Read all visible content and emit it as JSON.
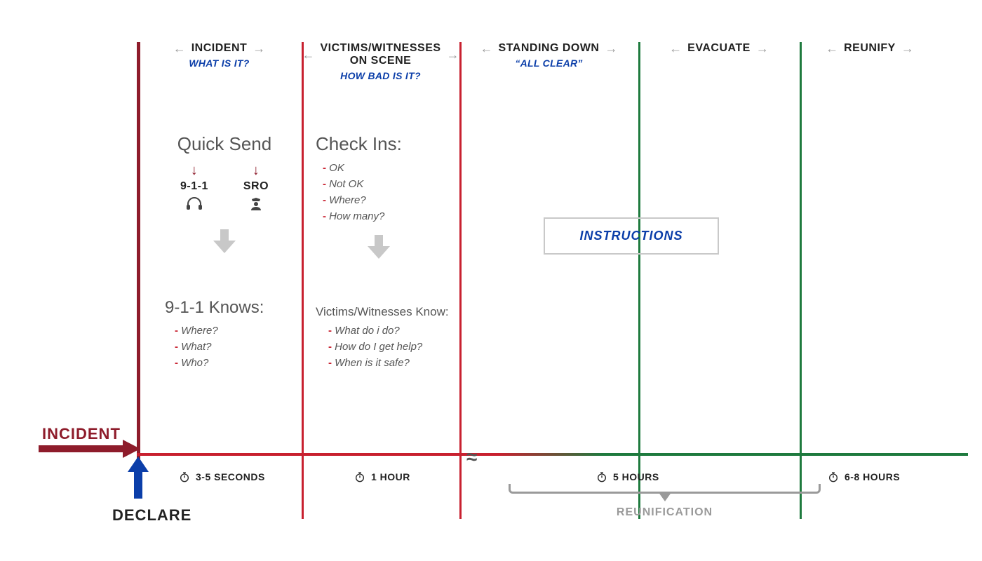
{
  "left": {
    "incident": "INCIDENT",
    "declare": "DECLARE"
  },
  "cols": {
    "c1": {
      "title": "INCIDENT",
      "sub": "WHAT IS IT?"
    },
    "c2": {
      "title": "VICTIMS/WITNESSES\nON SCENE",
      "sub": "HOW BAD IS IT?"
    },
    "c3": {
      "title": "STANDING DOWN",
      "sub": "“ALL CLEAR”"
    },
    "c4": {
      "title": "EVACUATE",
      "sub": ""
    },
    "c5": {
      "title": "REUNIFY",
      "sub": ""
    }
  },
  "col1": {
    "quick_title": "Quick Send",
    "left_label": "9-1-1",
    "right_label": "SRO",
    "knows_title": "9-1-1 Knows:",
    "knows": {
      "a": "Where?",
      "b": "What?",
      "c": "Who?"
    }
  },
  "col2": {
    "check_title": "Check Ins:",
    "check": {
      "a": "OK",
      "b": "Not OK",
      "c": "Where?",
      "d": "How many?"
    },
    "know_title": "Victims/Witnesses Know:",
    "know": {
      "a": "What do i do?",
      "b": "How do I get help?",
      "c": "When is it safe?"
    }
  },
  "instructions": "INSTRUCTIONS",
  "timeline": {
    "t1": "3-5 SECONDS",
    "t2": "1 HOUR",
    "t3": "5 HOURS",
    "t4": "6-8 HOURS"
  },
  "reunification": "REUNIFICATION",
  "colors": {
    "red_dark": "#8e1c2b",
    "red": "#c8202f",
    "green": "#1e7a3e",
    "blue": "#0b3ea9",
    "gray": "#9a9a9a"
  }
}
